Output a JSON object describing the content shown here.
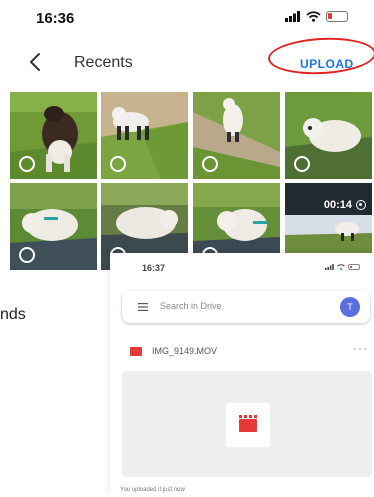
{
  "status_bar": {
    "time": "16:36"
  },
  "header": {
    "title": "Recents",
    "upload_label": "UPLOAD"
  },
  "grid": {
    "tiles": [
      {
        "name": "photo-tile-1",
        "video_duration": ""
      },
      {
        "name": "photo-tile-2",
        "video_duration": ""
      },
      {
        "name": "photo-tile-3",
        "video_duration": ""
      },
      {
        "name": "photo-tile-4",
        "video_duration": ""
      },
      {
        "name": "photo-tile-5",
        "video_duration": ""
      },
      {
        "name": "photo-tile-6",
        "video_duration": ""
      },
      {
        "name": "photo-tile-7",
        "video_duration": ""
      },
      {
        "name": "video-tile-8",
        "video_duration": "00:14"
      }
    ]
  },
  "partial_text": "nds",
  "drive": {
    "time": "16:37",
    "search_placeholder": "Search in Drive",
    "avatar_initial": "T",
    "file_name": "IMG_9149.MOV",
    "more_label": "···",
    "note": "You uploaded it just now"
  },
  "colors": {
    "accent": "#1a73e8",
    "highlight_ring": "#e02424",
    "file_red": "#e53935",
    "avatar": "#5b6ee1"
  }
}
